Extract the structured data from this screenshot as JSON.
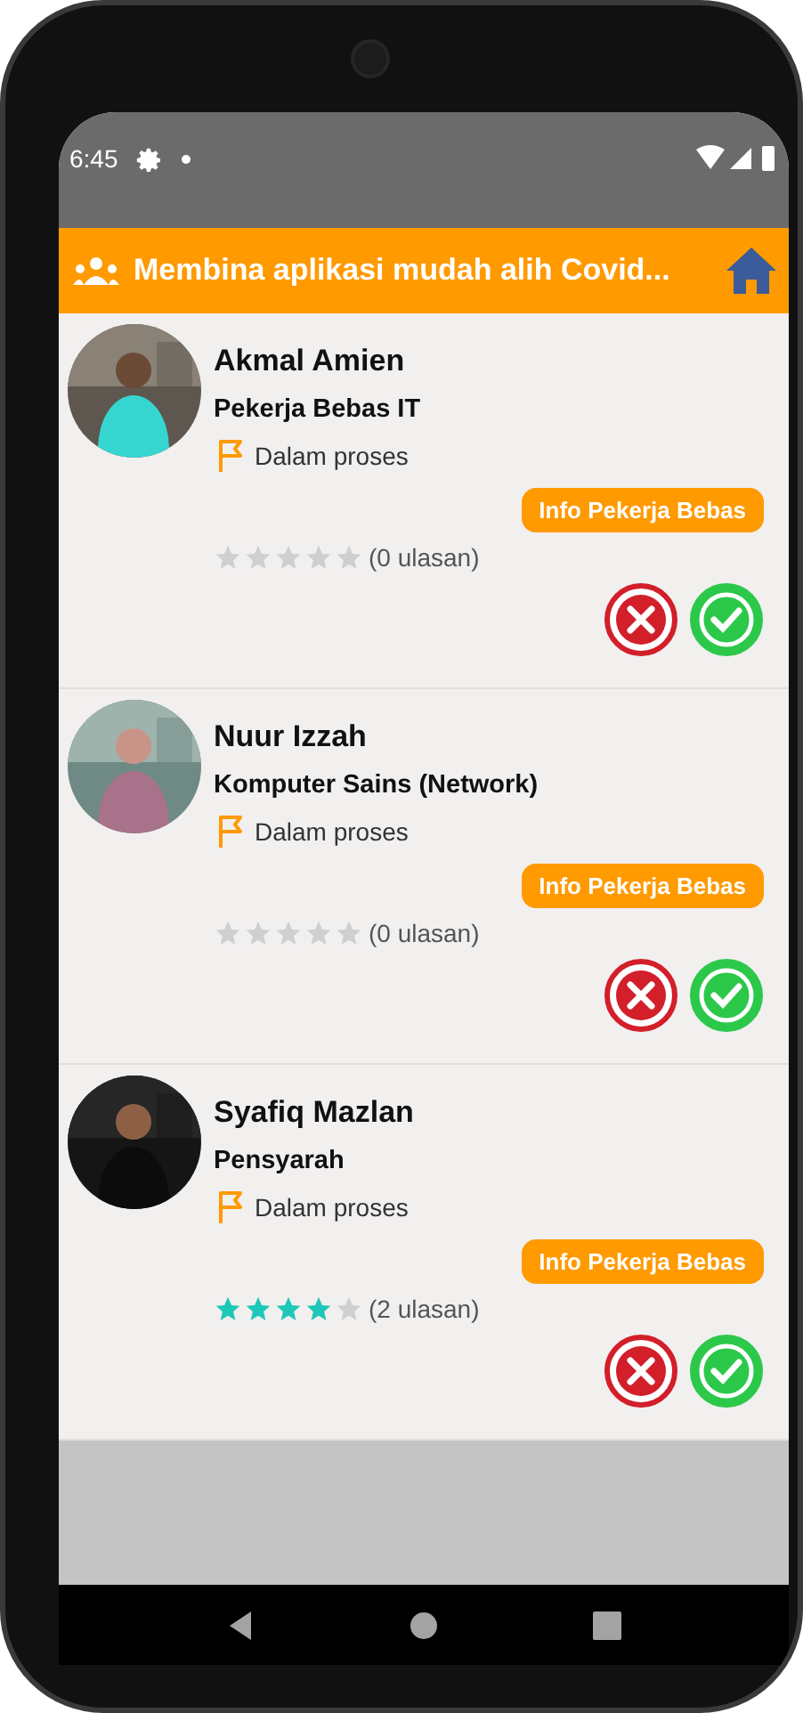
{
  "status_bar": {
    "time": "6:45"
  },
  "app_bar": {
    "title": "Membina aplikasi mudah alih Covid..."
  },
  "workers": [
    {
      "name": "Akmal Amien",
      "role": "Pekerja Bebas IT",
      "status": "Dalam proses",
      "info_button": "Info Pekerja Bebas",
      "stars": 0,
      "reviews": "(0 ulasan)",
      "kind": "picture"
    },
    {
      "name": "Nuur Izzah",
      "role": "Komputer Sains (Network)",
      "status": "Dalam proses",
      "info_button": "Info Pekerja Bebas",
      "stars": 0,
      "reviews": "(0 ulasan)",
      "kind": "picture"
    },
    {
      "name": "Syafiq Mazlan",
      "role": "Pensyarah",
      "status": "Dalam proses",
      "info_button": "Info Pekerja Bebas",
      "stars": 4,
      "reviews": "(2 ulasan)",
      "kind": "picture"
    }
  ]
}
